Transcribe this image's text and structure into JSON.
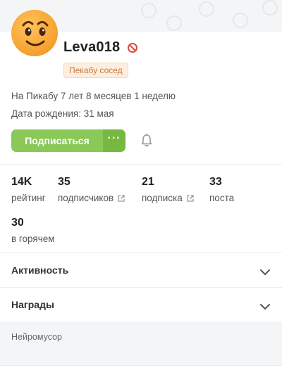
{
  "profile": {
    "username": "Leva018",
    "badge": "Пекабу сосед",
    "on_site": "На Пикабу 7 лет 8 месяцев 1 неделю",
    "birthday": "Дата рождения: 31 мая"
  },
  "actions": {
    "subscribe_label": "Подписаться",
    "more_label": "···"
  },
  "stats": [
    {
      "value": "14K",
      "label": "рейтинг"
    },
    {
      "value": "35",
      "label": "подписчиков"
    },
    {
      "value": "21",
      "label": "подписка"
    },
    {
      "value": "33",
      "label": "поста"
    },
    {
      "value": "30",
      "label": "в горячем"
    }
  ],
  "sections": {
    "activity": "Активность",
    "awards": "Награды"
  },
  "footer": {
    "text": "Нейромусор"
  },
  "colors": {
    "accent_green": "#8ac858",
    "accent_green_dark": "#76b842",
    "badge_text": "#c97a3c",
    "ban_red": "#e0493f"
  },
  "icons": {
    "ban": "ban-icon",
    "bell": "bell-icon",
    "external": "external-link-icon",
    "chevron": "chevron-down-icon"
  }
}
